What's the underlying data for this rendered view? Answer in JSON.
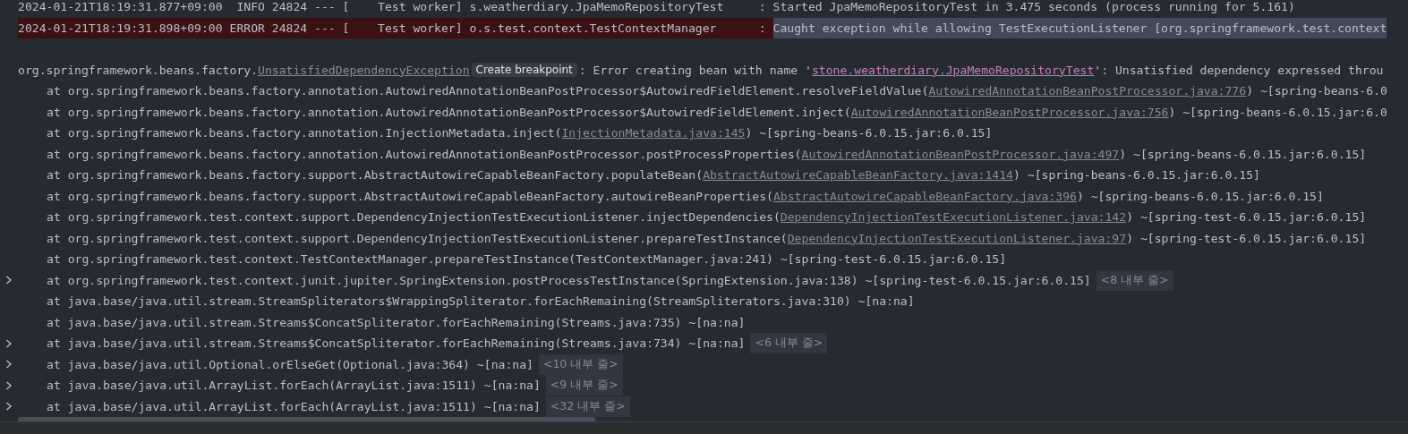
{
  "console": {
    "lines": [
      {
        "kind": "log",
        "highlighted": false,
        "expandable": false,
        "parts": [
          {
            "kind": "plain",
            "text": "2024-01-21T18:19:31.877+09:00  INFO 24824 --- [    Test worker] s.weatherdiary.JpaMemoRepositoryTest     : Started JpaMemoRepositoryTest in 3.475 seconds (process running for 5.161)"
          }
        ]
      },
      {
        "kind": "log",
        "highlighted": true,
        "expandable": false,
        "parts": [
          {
            "kind": "plain",
            "text": "2024-01-21T18:19:31.898+09:00 ERROR 24824 --- [    Test worker] o.s.test.context.TestContextManager      : "
          },
          {
            "kind": "selected",
            "text": "Caught exception while allowing TestExecutionListener [org.springframework.test.context"
          }
        ]
      },
      {
        "kind": "blank",
        "expandable": false
      },
      {
        "kind": "exception",
        "expandable": false,
        "parts": [
          {
            "kind": "plain",
            "text": "org.springframework.beans.factory."
          },
          {
            "kind": "link",
            "text": "UnsatisfiedDependencyException"
          },
          {
            "kind": "badge",
            "text": "Create breakpoint"
          },
          {
            "kind": "plain",
            "text": ": Error creating bean with name '"
          },
          {
            "kind": "quoted",
            "text": "stone.weatherdiary.JpaMemoRepositoryTest"
          },
          {
            "kind": "plain",
            "text": "': Unsatisfied dependency expressed throu"
          }
        ]
      },
      {
        "kind": "frame",
        "expandable": false,
        "parts": [
          {
            "kind": "plain",
            "text": "at org.springframework.beans.factory.annotation.AutowiredAnnotationBeanPostProcessor$AutowiredFieldElement.resolveFieldValue("
          },
          {
            "kind": "link",
            "text": "AutowiredAnnotationBeanPostProcessor.java:776"
          },
          {
            "kind": "plain",
            "text": ") ~[spring-beans-6.0"
          }
        ]
      },
      {
        "kind": "frame",
        "expandable": false,
        "parts": [
          {
            "kind": "plain",
            "text": "at org.springframework.beans.factory.annotation.AutowiredAnnotationBeanPostProcessor$AutowiredFieldElement.inject("
          },
          {
            "kind": "link",
            "text": "AutowiredAnnotationBeanPostProcessor.java:756"
          },
          {
            "kind": "plain",
            "text": ") ~[spring-beans-6.0.15.jar:6.0"
          }
        ]
      },
      {
        "kind": "frame",
        "expandable": false,
        "parts": [
          {
            "kind": "plain",
            "text": "at org.springframework.beans.factory.annotation.InjectionMetadata.inject("
          },
          {
            "kind": "link",
            "text": "InjectionMetadata.java:145"
          },
          {
            "kind": "plain",
            "text": ") ~[spring-beans-6.0.15.jar:6.0.15]"
          }
        ]
      },
      {
        "kind": "frame",
        "expandable": false,
        "parts": [
          {
            "kind": "plain",
            "text": "at org.springframework.beans.factory.annotation.AutowiredAnnotationBeanPostProcessor.postProcessProperties("
          },
          {
            "kind": "link",
            "text": "AutowiredAnnotationBeanPostProcessor.java:497"
          },
          {
            "kind": "plain",
            "text": ") ~[spring-beans-6.0.15.jar:6.0.15]"
          }
        ]
      },
      {
        "kind": "frame",
        "expandable": false,
        "parts": [
          {
            "kind": "plain",
            "text": "at org.springframework.beans.factory.support.AbstractAutowireCapableBeanFactory.populateBean("
          },
          {
            "kind": "link",
            "text": "AbstractAutowireCapableBeanFactory.java:1414"
          },
          {
            "kind": "plain",
            "text": ") ~[spring-beans-6.0.15.jar:6.0.15]"
          }
        ]
      },
      {
        "kind": "frame",
        "expandable": false,
        "parts": [
          {
            "kind": "plain",
            "text": "at org.springframework.beans.factory.support.AbstractAutowireCapableBeanFactory.autowireBeanProperties("
          },
          {
            "kind": "link",
            "text": "AbstractAutowireCapableBeanFactory.java:396"
          },
          {
            "kind": "plain",
            "text": ") ~[spring-beans-6.0.15.jar:6.0.15]"
          }
        ]
      },
      {
        "kind": "frame",
        "expandable": false,
        "parts": [
          {
            "kind": "plain",
            "text": "at org.springframework.test.context.support.DependencyInjectionTestExecutionListener.injectDependencies("
          },
          {
            "kind": "link",
            "text": "DependencyInjectionTestExecutionListener.java:142"
          },
          {
            "kind": "plain",
            "text": ") ~[spring-test-6.0.15.jar:6.0.15]"
          }
        ]
      },
      {
        "kind": "frame",
        "expandable": false,
        "parts": [
          {
            "kind": "plain",
            "text": "at org.springframework.test.context.support.DependencyInjectionTestExecutionListener.prepareTestInstance("
          },
          {
            "kind": "link",
            "text": "DependencyInjectionTestExecutionListener.java:97"
          },
          {
            "kind": "plain",
            "text": ") ~[spring-test-6.0.15.jar:6.0.15]"
          }
        ]
      },
      {
        "kind": "frame",
        "expandable": false,
        "parts": [
          {
            "kind": "plain",
            "text": "at org.springframework.test.context.TestContextManager.prepareTestInstance(TestContextManager.java:241) ~[spring-test-6.0.15.jar:6.0.15]"
          }
        ]
      },
      {
        "kind": "frame",
        "expandable": true,
        "parts": [
          {
            "kind": "plain",
            "text": "at org.springframework.test.context.junit.jupiter.SpringExtension.postProcessTestInstance(SpringExtension.java:138) ~[spring-test-6.0.15.jar:6.0.15]"
          },
          {
            "kind": "fold",
            "text": "<8 내부 줄>"
          }
        ]
      },
      {
        "kind": "frame",
        "expandable": false,
        "parts": [
          {
            "kind": "plain",
            "text": "at java.base/java.util.stream.StreamSpliterators$WrappingSpliterator.forEachRemaining(StreamSpliterators.java:310) ~[na:na]"
          }
        ]
      },
      {
        "kind": "frame",
        "expandable": false,
        "parts": [
          {
            "kind": "plain",
            "text": "at java.base/java.util.stream.Streams$ConcatSpliterator.forEachRemaining(Streams.java:735) ~[na:na]"
          }
        ]
      },
      {
        "kind": "frame",
        "expandable": true,
        "parts": [
          {
            "kind": "plain",
            "text": "at java.base/java.util.stream.Streams$ConcatSpliterator.forEachRemaining(Streams.java:734) ~[na:na]"
          },
          {
            "kind": "fold",
            "text": "<6 내부 줄>"
          }
        ]
      },
      {
        "kind": "frame",
        "expandable": true,
        "parts": [
          {
            "kind": "plain",
            "text": "at java.base/java.util.Optional.orElseGet(Optional.java:364) ~[na:na]"
          },
          {
            "kind": "fold",
            "text": "<10 내부 줄>"
          }
        ]
      },
      {
        "kind": "frame",
        "expandable": true,
        "parts": [
          {
            "kind": "plain",
            "text": "at java.base/java.util.ArrayList.forEach(ArrayList.java:1511) ~[na:na]"
          },
          {
            "kind": "fold",
            "text": "<9 내부 줄>"
          }
        ]
      },
      {
        "kind": "frame",
        "expandable": true,
        "parts": [
          {
            "kind": "plain",
            "text": "at java.base/java.util.ArrayList.forEach(ArrayList.java:1511) ~[na:na]"
          },
          {
            "kind": "fold",
            "text": "<32 내부 줄>"
          }
        ]
      }
    ]
  }
}
